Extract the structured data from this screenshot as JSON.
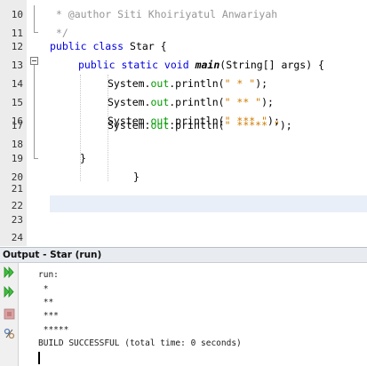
{
  "editor": {
    "lines": [
      {
        "num": "10",
        "text": " * @author Siti Khoiriyatul Anwariyah"
      },
      {
        "num": "11",
        "text": " */"
      },
      {
        "num": "12",
        "kw": "public class",
        "rest": " Star {"
      },
      {
        "num": "13",
        "kw": "public static void",
        "method": "main",
        "rest": "(String[] args) {"
      },
      {
        "num": "14",
        "cls": "System.",
        "field": "out",
        "call": ".println(",
        "str": "\" * \"",
        "end": ");"
      },
      {
        "num": "15",
        "cls": "System.",
        "field": "out",
        "call": ".println(",
        "str": "\" ** \"",
        "end": ");"
      },
      {
        "num": "16",
        "cls": "System.",
        "field": "out",
        "call": ".println(",
        "str": "\" *** \"",
        "end": ");"
      },
      {
        "num": "17",
        "cls": "System.",
        "field": "out",
        "call": ".println(",
        "str": "\" ***** \"",
        "end": ");"
      },
      {
        "num": "18"
      },
      {
        "num": "19",
        "text": "}"
      },
      {
        "num": "20",
        "text": "}"
      },
      {
        "num": "21"
      },
      {
        "num": "22"
      },
      {
        "num": "23"
      },
      {
        "num": "24"
      }
    ]
  },
  "output": {
    "title": "Output - Star (run)",
    "lines": [
      "run:",
      " *",
      " **",
      " ***",
      " *****",
      "BUILD SUCCESSFUL (total time: 0 seconds)"
    ]
  },
  "colors": {
    "keyword": "#0000e6",
    "string": "#ce7b00",
    "field": "#009900",
    "comment": "#969696",
    "run_icon": "#2fb52f",
    "current_line": "#e9eff8"
  }
}
